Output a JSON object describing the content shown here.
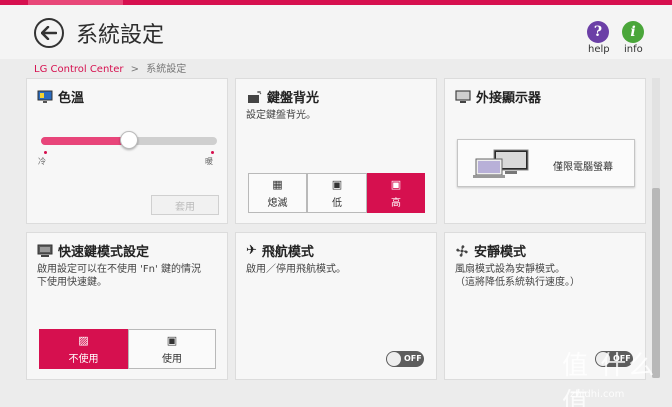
{
  "header": {
    "title": "系統設定",
    "help_label": "help",
    "info_label": "info"
  },
  "breadcrumb": {
    "root": "LG Control Center",
    "separator": ">",
    "current": "系統設定"
  },
  "color_temp": {
    "title": "色溫",
    "min_label": "冷",
    "max_label": "暖",
    "level": 0.5,
    "apply_label": "套用"
  },
  "keyboard_backlight": {
    "title": "鍵盤背光",
    "desc": "設定鍵盤背光。",
    "options": [
      "熄滅",
      "低",
      "高"
    ],
    "selected": "高"
  },
  "external_display": {
    "title": "外接顯示器",
    "button_label": "僅限電腦螢幕"
  },
  "hotkey_mode": {
    "title": "快速鍵模式設定",
    "desc": "啟用設定可以在不使用 'Fn' 鍵的情況\n下使用快速鍵。",
    "options": [
      "不使用",
      "使用"
    ],
    "selected": "不使用"
  },
  "airplane_mode": {
    "title": "飛航模式",
    "desc": "啟用／停用飛航模式。",
    "toggle_label": "OFF"
  },
  "silent_mode": {
    "title": "安靜模式",
    "desc": "風扇模式設為安靜模式。\n（這將降低系統執行速度。）",
    "toggle_label": "OFF"
  },
  "watermark": {
    "text": "值 什么值",
    "sub": "zhidhi.com"
  },
  "colors": {
    "accent": "#d6104f",
    "panel": "#f7f7f7",
    "background": "#ececec"
  }
}
